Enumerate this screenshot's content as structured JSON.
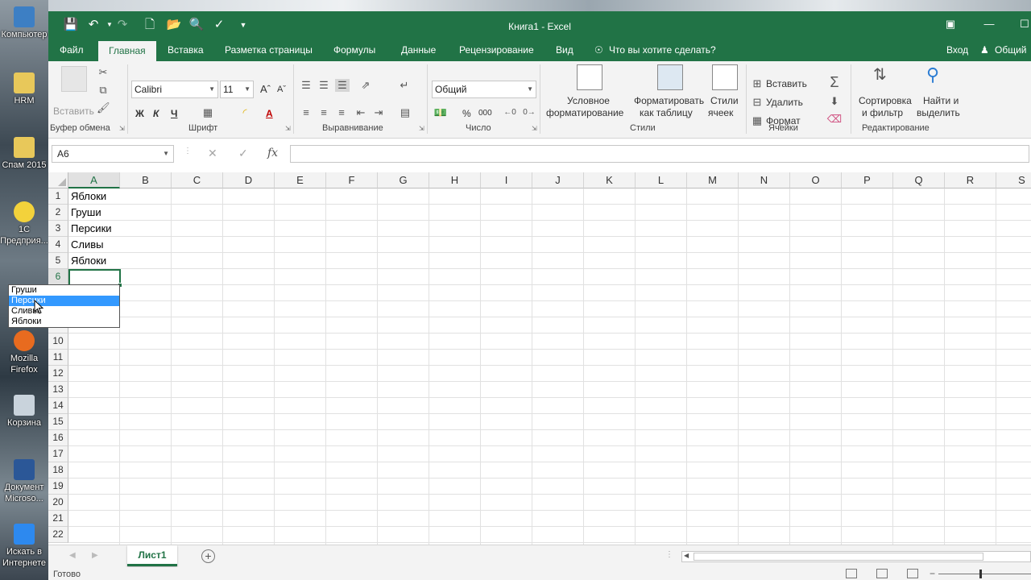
{
  "desktop": {
    "icons": [
      {
        "label": "Компьютер",
        "icon": "computer-icon"
      },
      {
        "label": "HRM",
        "icon": "folder-icon"
      },
      {
        "label": "Спам 2015",
        "icon": "folder-icon"
      },
      {
        "label": "1С Предприя...",
        "icon": "1c-icon"
      },
      {
        "label": "Mozilla Firefox",
        "icon": "firefox-icon"
      },
      {
        "label": "Корзина",
        "icon": "recycle-bin-icon"
      },
      {
        "label": "Документ Microso...",
        "icon": "word-document-icon"
      },
      {
        "label": "Искать в Интернете",
        "icon": "search-web-icon"
      }
    ]
  },
  "window": {
    "title": "Книга1 - Excel",
    "accent": "#217346"
  },
  "tabs": {
    "file": "Файл",
    "home": "Главная",
    "insert": "Вставка",
    "page_layout": "Разметка страницы",
    "formulas": "Формулы",
    "data": "Данные",
    "review": "Рецензирование",
    "view": "Вид",
    "tell_me": "Что вы хотите сделать?",
    "sign_in": "Вход",
    "share": "Общий"
  },
  "ribbon": {
    "clipboard": {
      "paste": "Вставить",
      "label": "Буфер обмена"
    },
    "font": {
      "name": "Calibri",
      "size": "11",
      "bold": "Ж",
      "italic": "К",
      "underline": "Ч",
      "label": "Шрифт"
    },
    "alignment": {
      "label": "Выравнивание"
    },
    "number": {
      "format": "Общий",
      "percent": "%",
      "thousands": "000",
      "label": "Число"
    },
    "styles": {
      "conditional_1": "Условное",
      "conditional_2": "форматирование",
      "format_table_1": "Форматировать",
      "format_table_2": "как таблицу",
      "cell_styles_1": "Стили",
      "cell_styles_2": "ячеек",
      "label": "Стили"
    },
    "cells": {
      "insert": "Вставить",
      "delete": "Удалить",
      "format": "Формат",
      "label": "Ячейки"
    },
    "editing": {
      "sort_1": "Сортировка",
      "sort_2": "и фильтр",
      "find_1": "Найти и",
      "find_2": "выделить",
      "label": "Редактирование"
    }
  },
  "formula_bar": {
    "name_box": "A6",
    "fx": "fx",
    "value": ""
  },
  "grid": {
    "columns": [
      "A",
      "B",
      "C",
      "D",
      "E",
      "F",
      "G",
      "H",
      "I",
      "J",
      "K",
      "L",
      "M",
      "N",
      "O",
      "P",
      "Q",
      "R",
      "S"
    ],
    "rows": [
      "1",
      "2",
      "3",
      "4",
      "5",
      "6",
      "7",
      "8",
      "9",
      "10",
      "11",
      "12",
      "13",
      "14",
      "15",
      "16",
      "17",
      "18",
      "19",
      "20",
      "21",
      "22"
    ],
    "column_a_values": [
      "Яблоки",
      "Груши",
      "Персики",
      "Сливы",
      "Яблоки"
    ],
    "active_cell": "A6"
  },
  "dropdown": {
    "items": [
      "Груши",
      "Персики",
      "Сливы",
      "Яблоки"
    ],
    "highlighted": "Персики",
    "highlight_color": "#3399ff"
  },
  "sheets": {
    "tabs": [
      "Лист1"
    ],
    "active": "Лист1"
  },
  "status": {
    "text": "Готово"
  }
}
